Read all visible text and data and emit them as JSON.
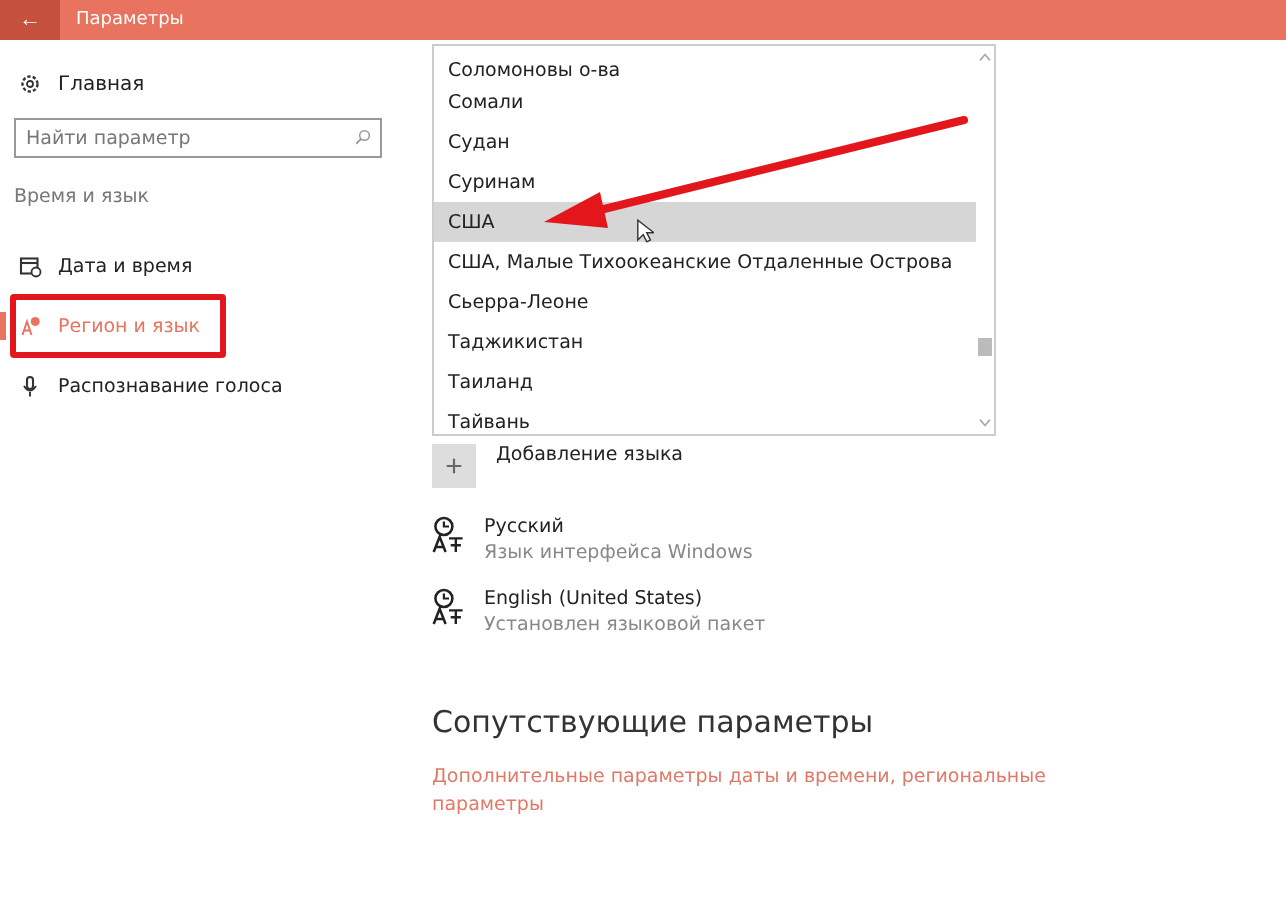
{
  "window": {
    "title": "Параметры",
    "back": "←"
  },
  "sidebar": {
    "home": "Главная",
    "search": {
      "placeholder": "Найти параметр"
    },
    "section": "Время и язык",
    "items": [
      {
        "label": "Дата и время",
        "selected": false
      },
      {
        "label": "Регион и язык",
        "selected": true
      },
      {
        "label": "Распознавание голоса",
        "selected": false
      }
    ]
  },
  "country_list": {
    "items": [
      {
        "label": "Соломоновы о-ва",
        "selected": false
      },
      {
        "label": "Сомали",
        "selected": false
      },
      {
        "label": "Судан",
        "selected": false
      },
      {
        "label": "Суринам",
        "selected": false
      },
      {
        "label": "США",
        "selected": true
      },
      {
        "label": "США, Малые Тихоокеанские Отдаленные Острова",
        "selected": false
      },
      {
        "label": "Сьерра-Леоне",
        "selected": false
      },
      {
        "label": "Таджикистан",
        "selected": false
      },
      {
        "label": "Таиланд",
        "selected": false
      },
      {
        "label": "Тайвань",
        "selected": false
      }
    ]
  },
  "add_language": {
    "icon": "+",
    "label": "Добавление языка"
  },
  "languages": [
    {
      "name": "Русский",
      "status": "Язык интерфейса Windows"
    },
    {
      "name": "English (United States)",
      "status": "Установлен языковой пакет"
    }
  ],
  "related": {
    "heading": "Сопутствующие параметры",
    "link": "Дополнительные параметры даты и времени, региональные параметры"
  }
}
